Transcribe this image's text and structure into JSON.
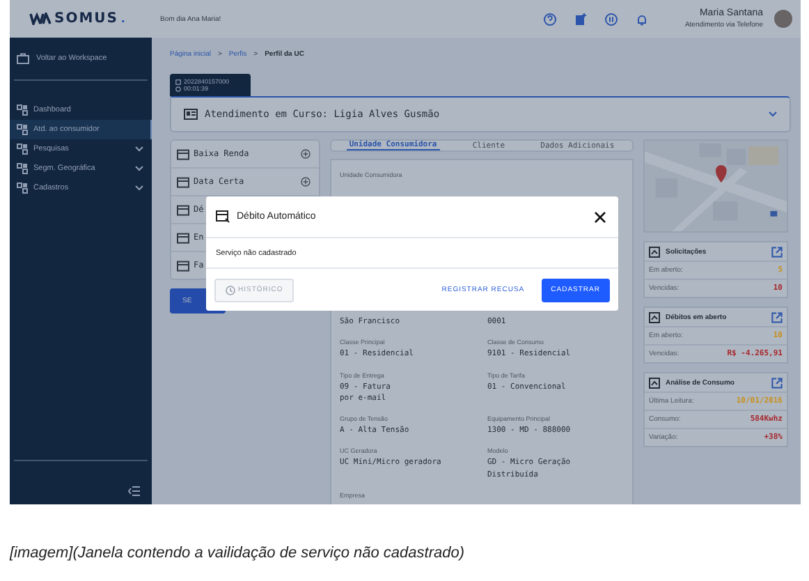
{
  "header": {
    "logo": "SOMUS",
    "logo_dot": ".",
    "greeting": "Bom dia Ana Maria!",
    "user_name": "Maria Santana",
    "user_role": "Atendimento via Telefone"
  },
  "sidebar": {
    "back": "Voltar ao Workspace",
    "items": [
      {
        "label": "Dashboard",
        "selected": false,
        "expandable": false
      },
      {
        "label": "Atd. ao consumidor",
        "selected": true,
        "expandable": false
      },
      {
        "label": "Pesquisas",
        "selected": false,
        "expandable": true
      },
      {
        "label": "Segm. Geográfica",
        "selected": false,
        "expandable": true
      },
      {
        "label": "Cadastros",
        "selected": false,
        "expandable": true
      }
    ]
  },
  "breadcrumb": [
    {
      "label": "Página inicial",
      "current": false
    },
    {
      "label": "Perfis",
      "current": false
    },
    {
      "label": "Perfil da UC",
      "current": true
    }
  ],
  "breadcrumb_separator": ">",
  "session": {
    "protocol": "2022840157000",
    "timer": "00:01:39"
  },
  "attendance": "Atendimento em Curso: Ligia Alves Gusmão",
  "services": [
    {
      "label": "Baixa Renda",
      "addable": true
    },
    {
      "label": "Data Certa",
      "addable": true
    },
    {
      "label": "Dé"
    },
    {
      "label": "En"
    },
    {
      "label": "Fa"
    }
  ],
  "services_button": "SE",
  "tabs": [
    {
      "label": "Unidade Consumidora",
      "selected": true
    },
    {
      "label": "Cliente",
      "selected": false
    },
    {
      "label": "Dados Adicionais",
      "selected": false
    }
  ],
  "details": {
    "title": "Unidade Consumidora",
    "rows": [
      [
        {
          "value": "São Francisco"
        },
        {
          "value": "0001"
        }
      ],
      [
        {
          "label": "Classe Principal",
          "value": "01 - Residencial"
        },
        {
          "label": "Classe de Consumo",
          "value": "9101 - Residencial"
        }
      ],
      [
        {
          "label": "Tipo de Entrega",
          "value": "09 - Fatura\n por e-mail"
        },
        {
          "label": "Tipo de Tarifa",
          "value": "01 - Convencional"
        }
      ],
      [
        {
          "label": "Grupo de  Tensão",
          "value": "A - Alta Tensão"
        },
        {
          "label": "Equipamento Principal",
          "value": "1300 - MD - 888000"
        }
      ],
      [
        {
          "label": "UC Geradora",
          "value": "UC Mini/Micro geradora"
        },
        {
          "label": "Modelo",
          "value": "GD - Micro Geração\nDistribuída"
        }
      ],
      [
        {
          "label": "Empresa"
        }
      ]
    ]
  },
  "cards": [
    {
      "title": "Solicitações",
      "rows": [
        {
          "label": "Em aberto:",
          "value": "5",
          "color": "#c8901c"
        },
        {
          "label": "Vencidas:",
          "value": "10",
          "color": "#a8282e"
        }
      ]
    },
    {
      "title": "Débitos em aberto",
      "rows": [
        {
          "label": "Em aberto:",
          "value": "10",
          "color": "#c8901c"
        },
        {
          "label": "Vencidas:",
          "value": "R$ -4.265,91",
          "color": "#a8282e"
        }
      ]
    },
    {
      "title": "Análise de Consumo",
      "rows": [
        {
          "label": "Última Leitura:",
          "value": "10/01/2016",
          "color": "#c8901c"
        },
        {
          "label": "Consumo:",
          "value": "584Kwhz",
          "color": "#a8282e"
        },
        {
          "label": "Variação:",
          "value": "+38%",
          "color": "#a8282e"
        }
      ]
    }
  ],
  "modal": {
    "title": "Débito Automático",
    "message": "Serviço não cadastrado",
    "history": "HISTÓRICO",
    "refuse": "REGISTRAR RECUSA",
    "confirm": "CADASTRAR"
  },
  "caption": "[imagem](Janela contendo a vailidação de serviço não cadastrado)"
}
